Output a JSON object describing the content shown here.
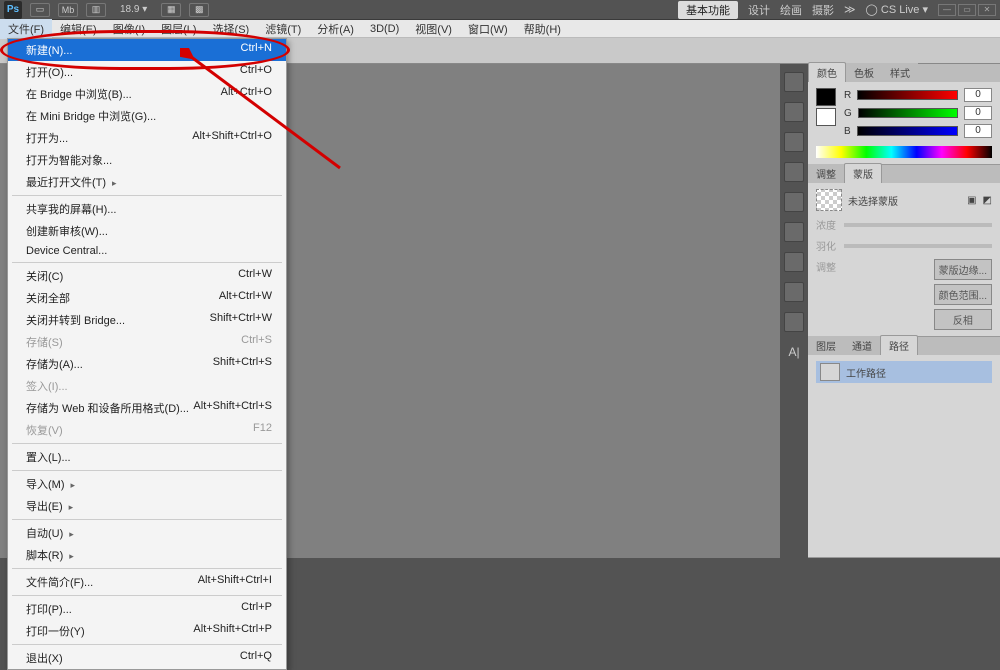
{
  "topbar": {
    "logo": "Ps",
    "zoom": "18.9",
    "cslive": "CS Live"
  },
  "top_right": {
    "basic": "基本功能",
    "design": "设计",
    "paint": "绘画",
    "photo": "摄影"
  },
  "menu": {
    "file": "文件(F)",
    "edit": "编辑(E)",
    "image": "图像(I)",
    "layer": "图层(L)",
    "select": "选择(S)",
    "filter": "滤镜(T)",
    "analysis": "分析(A)",
    "threeD": "3D(D)",
    "view": "视图(V)",
    "window": "窗口(W)",
    "help": "帮助(H)"
  },
  "file_menu": [
    {
      "label": "新建(N)...",
      "shortcut": "Ctrl+N",
      "hl": true
    },
    {
      "label": "打开(O)...",
      "shortcut": "Ctrl+O"
    },
    {
      "label": "在 Bridge 中浏览(B)...",
      "shortcut": "Alt+Ctrl+O"
    },
    {
      "label": "在 Mini Bridge 中浏览(G)...",
      "shortcut": ""
    },
    {
      "label": "打开为...",
      "shortcut": "Alt+Shift+Ctrl+O"
    },
    {
      "label": "打开为智能对象...",
      "shortcut": ""
    },
    {
      "label": "最近打开文件(T)",
      "shortcut": "",
      "arrow": true
    },
    {
      "sep": true
    },
    {
      "label": "共享我的屏幕(H)...",
      "shortcut": ""
    },
    {
      "label": "创建新审核(W)...",
      "shortcut": ""
    },
    {
      "label": "Device Central...",
      "shortcut": ""
    },
    {
      "sep": true
    },
    {
      "label": "关闭(C)",
      "shortcut": "Ctrl+W"
    },
    {
      "label": "关闭全部",
      "shortcut": "Alt+Ctrl+W"
    },
    {
      "label": "关闭并转到 Bridge...",
      "shortcut": "Shift+Ctrl+W"
    },
    {
      "label": "存储(S)",
      "shortcut": "Ctrl+S",
      "disabled": true
    },
    {
      "label": "存储为(A)...",
      "shortcut": "Shift+Ctrl+S"
    },
    {
      "label": "签入(I)...",
      "shortcut": "",
      "disabled": true
    },
    {
      "label": "存储为 Web 和设备所用格式(D)...",
      "shortcut": "Alt+Shift+Ctrl+S"
    },
    {
      "label": "恢复(V)",
      "shortcut": "F12",
      "disabled": true
    },
    {
      "sep": true
    },
    {
      "label": "置入(L)...",
      "shortcut": ""
    },
    {
      "sep": true
    },
    {
      "label": "导入(M)",
      "shortcut": "",
      "arrow": true
    },
    {
      "label": "导出(E)",
      "shortcut": "",
      "arrow": true
    },
    {
      "sep": true
    },
    {
      "label": "自动(U)",
      "shortcut": "",
      "arrow": true
    },
    {
      "label": "脚本(R)",
      "shortcut": "",
      "arrow": true
    },
    {
      "sep": true
    },
    {
      "label": "文件简介(F)...",
      "shortcut": "Alt+Shift+Ctrl+I"
    },
    {
      "sep": true
    },
    {
      "label": "打印(P)...",
      "shortcut": "Ctrl+P"
    },
    {
      "label": "打印一份(Y)",
      "shortcut": "Alt+Shift+Ctrl+P"
    },
    {
      "sep": true
    },
    {
      "label": "退出(X)",
      "shortcut": "Ctrl+Q"
    }
  ],
  "panels": {
    "color": {
      "tab_color": "颜色",
      "tab_swatches": "色板",
      "tab_styles": "样式",
      "r": "R",
      "g": "G",
      "b": "B",
      "val": "0"
    },
    "masks": {
      "tab_adjust": "调整",
      "tab_masks": "蒙版",
      "not_selected": "未选择蒙版",
      "density": "浓度",
      "feather": "羽化",
      "adjust": "调整",
      "btn_edge": "蒙版边缘...",
      "btn_range": "颜色范围...",
      "btn_invert": "反相"
    },
    "paths": {
      "tab_layers": "图层",
      "tab_channels": "通道",
      "tab_paths": "路径",
      "workpath": "工作路径"
    }
  }
}
